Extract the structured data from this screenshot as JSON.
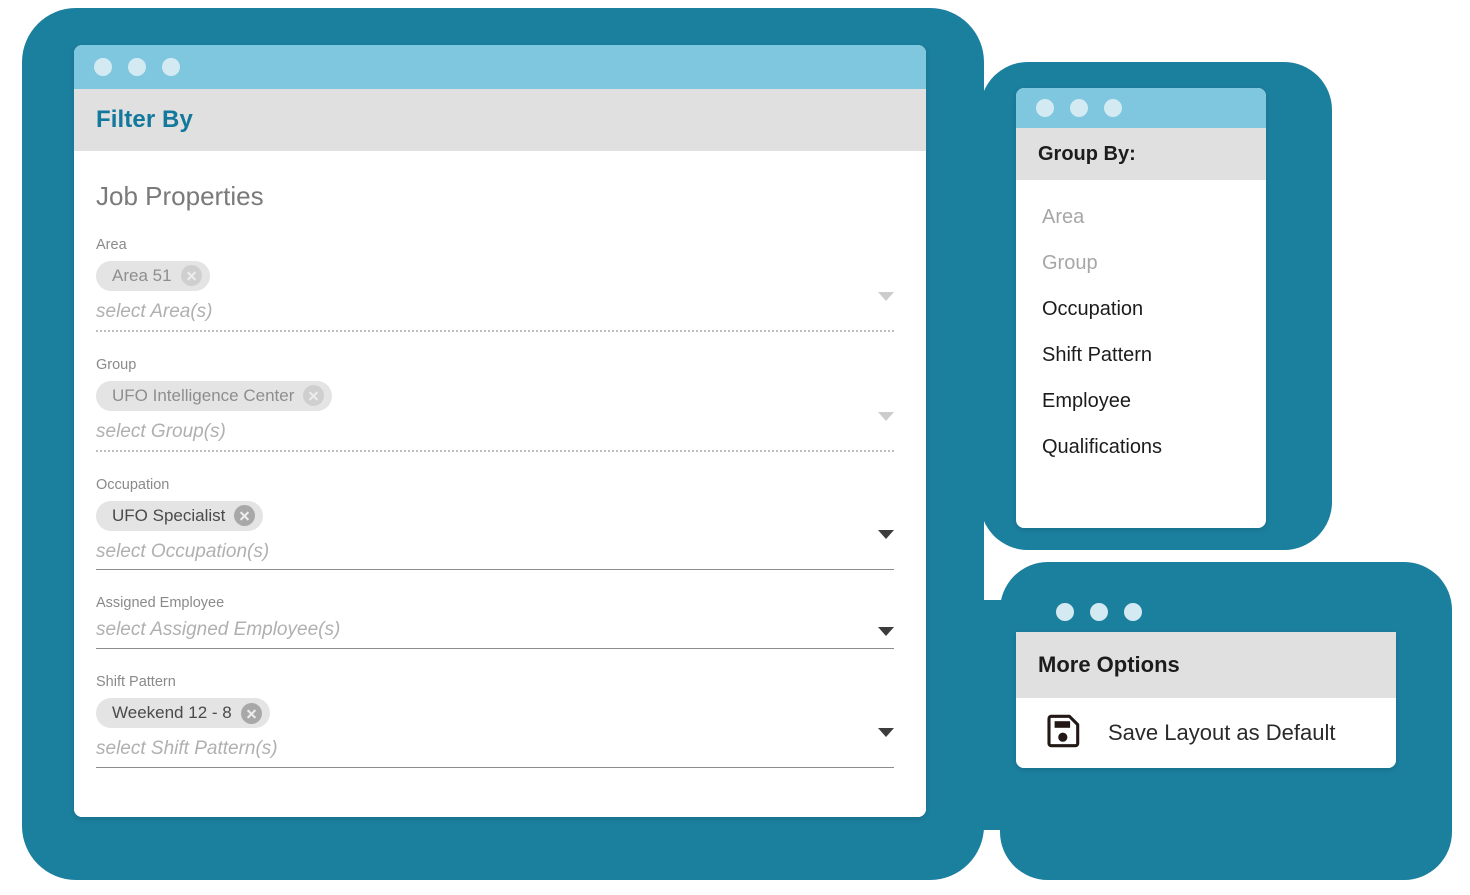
{
  "colors": {
    "backdrop_teal": "#1B7F9E",
    "titlebar_blue": "#7FC6DF",
    "titlebar_dot": "#D4EAF2",
    "header_band_gray": "#E0E0E0",
    "filter_title_teal": "#12789C",
    "chip_bg": "#E4E4E4"
  },
  "filter_window": {
    "title": "Filter By",
    "section_heading": "Job Properties",
    "fields": [
      {
        "label": "Area",
        "placeholder": "select Area(s)",
        "chips": [
          "Area 51"
        ],
        "disabled": true
      },
      {
        "label": "Group",
        "placeholder": "select Group(s)",
        "chips": [
          "UFO Intelligence Center"
        ],
        "disabled": true
      },
      {
        "label": "Occupation",
        "placeholder": "select Occupation(s)",
        "chips": [
          "UFO Specialist"
        ],
        "disabled": false
      },
      {
        "label": "Assigned Employee",
        "placeholder": "select Assigned Employee(s)",
        "chips": [],
        "disabled": false
      },
      {
        "label": "Shift Pattern",
        "placeholder": "select Shift Pattern(s)",
        "chips": [
          "Weekend 12 - 8"
        ],
        "disabled": false
      }
    ]
  },
  "group_by_window": {
    "title": "Group By:",
    "items": [
      {
        "label": "Area",
        "disabled": true
      },
      {
        "label": "Group",
        "disabled": true
      },
      {
        "label": "Occupation",
        "disabled": false
      },
      {
        "label": "Shift Pattern",
        "disabled": false
      },
      {
        "label": "Employee",
        "disabled": false
      },
      {
        "label": "Qualifications",
        "disabled": false
      }
    ]
  },
  "more_options_window": {
    "title": "More Options",
    "save_icon": "floppy-disk-icon",
    "save_label": "Save Layout as Default"
  }
}
